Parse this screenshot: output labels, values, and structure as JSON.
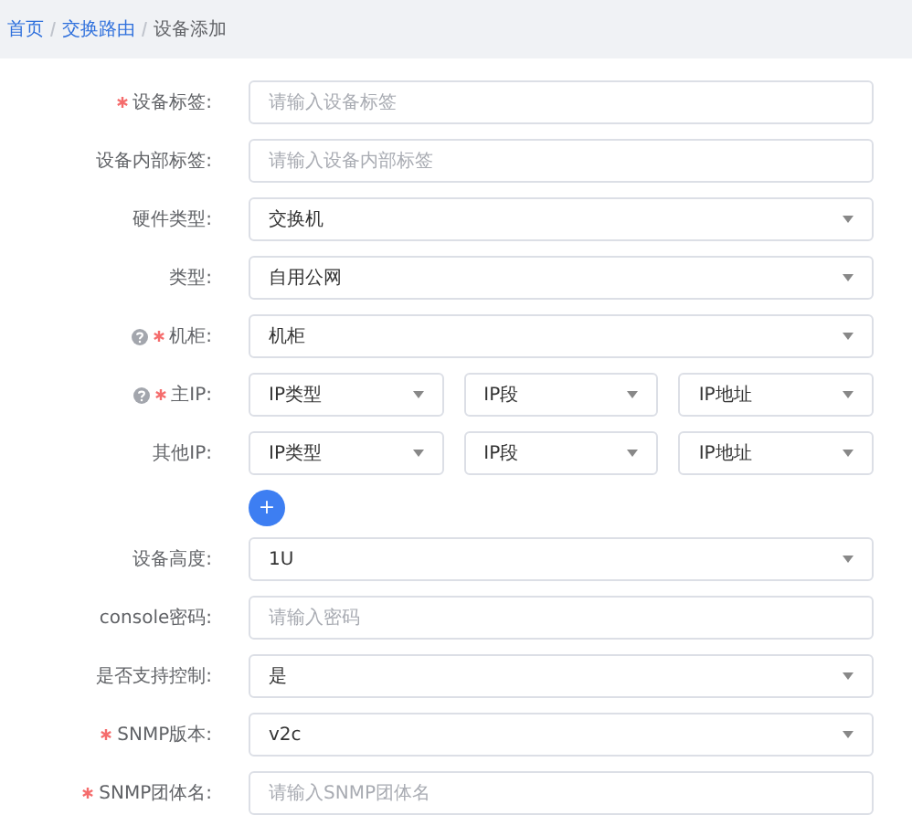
{
  "breadcrumb": [
    {
      "label": "首页",
      "current": false
    },
    {
      "label": "交换路由",
      "current": false
    },
    {
      "label": "设备添加",
      "current": true
    }
  ],
  "form": [
    {
      "kind": "input",
      "label": "设备标签:",
      "required": true,
      "help": false,
      "placeholder": "请输入设备标签"
    },
    {
      "kind": "input",
      "label": "设备内部标签:",
      "required": false,
      "help": false,
      "placeholder": "请输入设备内部标签"
    },
    {
      "kind": "select",
      "label": "硬件类型:",
      "required": false,
      "help": false,
      "value": "交换机"
    },
    {
      "kind": "select",
      "label": "类型:",
      "required": false,
      "help": false,
      "value": "自用公网"
    },
    {
      "kind": "select",
      "label": "机柜:",
      "required": true,
      "help": true,
      "value": "机柜"
    },
    {
      "kind": "ip",
      "label": "主IP:",
      "required": true,
      "help": true,
      "values": [
        "IP类型",
        "IP段",
        "IP地址"
      ]
    },
    {
      "kind": "ip",
      "label": "其他IP:",
      "required": false,
      "help": false,
      "values": [
        "IP类型",
        "IP段",
        "IP地址"
      ]
    },
    {
      "kind": "add",
      "label": "+"
    },
    {
      "kind": "select",
      "label": "设备高度:",
      "required": false,
      "help": false,
      "value": "1U"
    },
    {
      "kind": "input",
      "label": "console密码:",
      "required": false,
      "help": false,
      "placeholder": "请输入密码"
    },
    {
      "kind": "select",
      "label": "是否支持控制:",
      "required": false,
      "help": false,
      "value": "是"
    },
    {
      "kind": "select",
      "label": "SNMP版本:",
      "required": true,
      "help": false,
      "value": "v2c"
    },
    {
      "kind": "input",
      "label": "SNMP团体名:",
      "required": true,
      "help": false,
      "placeholder": "请输入SNMP团体名"
    }
  ]
}
